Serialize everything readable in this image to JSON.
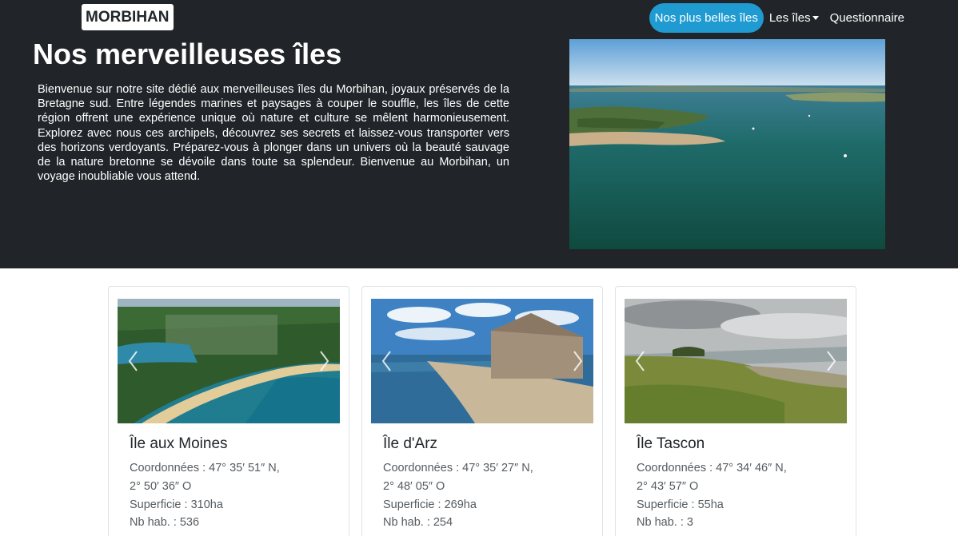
{
  "header": {
    "brand": "MORBIHAN",
    "nav": [
      {
        "label": "Nos plus belles îles",
        "active": true
      },
      {
        "label": "Les îles",
        "dropdown": true
      },
      {
        "label": "Questionnaire"
      }
    ]
  },
  "hero": {
    "title": "Nos merveilleuses îles",
    "text": "Bienvenue sur notre site dédié aux merveilleuses îles du Morbihan, joyaux préservés de la Bretagne sud. Entre légendes marines et paysages à couper le souffle, les îles de cette région offrent une expérience unique où nature et culture se mêlent harmonieusement. Explorez avec nous ces archipels, découvrez ses secrets et laissez-vous transporter vers des horizons verdoyants. Préparez-vous à plonger dans un univers où la beauté sauvage de la nature bretonne se dévoile dans toute sa splendeur. Bienvenue au Morbihan, un voyage inoubliable vous attend.",
    "image_icon": "aerial-sea-photo"
  },
  "cards": [
    {
      "title": "Île aux Moines",
      "coord_line1": "Coordonnées : 47° 35′ 51″ N,",
      "coord_line2": "2° 50′ 36″ O",
      "area": "Superficie : 310ha",
      "population": "Nb hab. : 536"
    },
    {
      "title": "Île d'Arz",
      "coord_line1": "Coordonnées : 47° 35′ 27″ N,",
      "coord_line2": "2° 48′ 05″ O",
      "area": "Superficie : 269ha",
      "population": "Nb hab. : 254"
    },
    {
      "title": "Île Tascon",
      "coord_line1": "Coordonnées : 47° 34′ 46″ N,",
      "coord_line2": "2° 43′ 57″ O",
      "area": "Superficie : 55ha",
      "population": "Nb hab. : 3"
    }
  ],
  "colors": {
    "dark_bg": "#212529",
    "active_nav": "#1f9bd1",
    "card_border": "#dfe2e6"
  }
}
